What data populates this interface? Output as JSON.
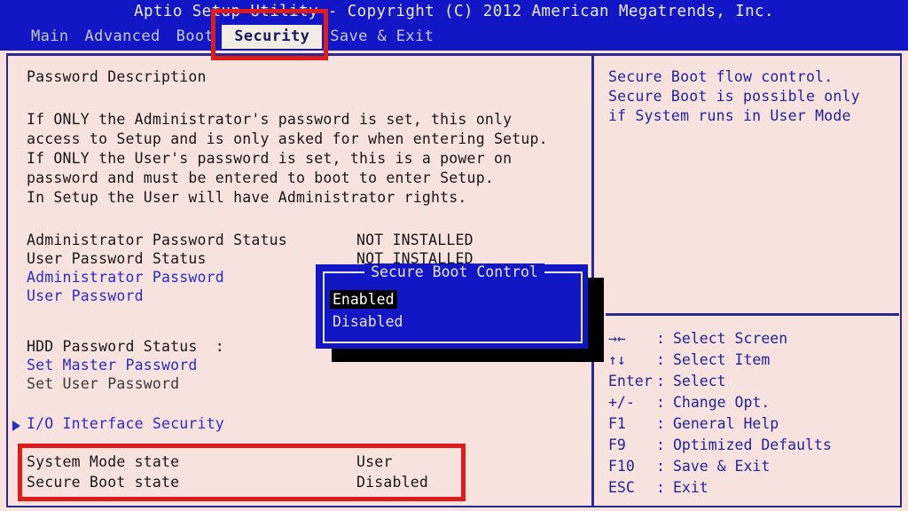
{
  "window": {
    "title": "Aptio Setup Utility - Copyright (C) 2012 American Megatrends, Inc."
  },
  "menu": {
    "tabs": [
      {
        "label": "Main",
        "active": false
      },
      {
        "label": "Advanced",
        "active": false
      },
      {
        "label": "Boot",
        "active": false
      },
      {
        "label": "Security",
        "active": true
      },
      {
        "label": "Save & Exit",
        "active": false
      }
    ]
  },
  "left_pane": {
    "section_title": "Password Description",
    "description_lines": [
      "If ONLY the Administrator's password is set, this only",
      "access to Setup and is only asked for when entering Setup.",
      "If ONLY the User's password is set, this is a power on",
      "password and must be entered to boot to enter Setup.",
      "In Setup the User will have Administrator rights."
    ],
    "status_rows": [
      {
        "label": "Administrator Password Status",
        "value": "NOT INSTALLED"
      },
      {
        "label": "User Password Status",
        "value": "NOT INSTALLED"
      }
    ],
    "password_items": [
      {
        "label": "Administrator Password",
        "state": "enabled"
      },
      {
        "label": "User Password",
        "state": "enabled"
      }
    ],
    "hdd_status_label": "HDD Password Status  :",
    "hdd_items": [
      {
        "label": "Set Master Password",
        "state": "enabled"
      },
      {
        "label": "Set User Password",
        "state": "disabled"
      }
    ],
    "submenu": {
      "marker": "triangle-right-icon",
      "label": "I/O Interface Security"
    },
    "state_rows": [
      {
        "label": "System Mode state",
        "value": "User"
      },
      {
        "label": "Secure Boot state",
        "value": "Disabled"
      }
    ]
  },
  "popup": {
    "title": "Secure Boot Control",
    "options": [
      {
        "label": "Enabled",
        "selected": true
      },
      {
        "label": "Disabled",
        "selected": false
      }
    ]
  },
  "right_pane": {
    "help_lines": [
      "Secure Boot flow control.",
      "Secure Boot is possible only",
      "if System runs in User Mode"
    ],
    "key_legend": [
      {
        "key": "→←",
        "sep": ":",
        "label": "Select Screen",
        "icon": "arrow-left-right-icon"
      },
      {
        "key": "↑↓",
        "sep": ":",
        "label": "Select Item",
        "icon": "arrow-up-down-icon"
      },
      {
        "key": "Enter",
        "sep": ":",
        "label": "Select",
        "icon": ""
      },
      {
        "key": "+/-",
        "sep": ":",
        "label": "Change Opt.",
        "icon": ""
      },
      {
        "key": "F1",
        "sep": ":",
        "label": "General Help",
        "icon": ""
      },
      {
        "key": "F9",
        "sep": ":",
        "label": "Optimized Defaults",
        "icon": ""
      },
      {
        "key": "F10",
        "sep": ":",
        "label": "Save & Exit",
        "icon": ""
      },
      {
        "key": "ESC",
        "sep": ":",
        "label": "Exit",
        "icon": ""
      }
    ]
  },
  "annotations": [
    {
      "name": "security-tab-highlight",
      "color": "#e01b1b"
    },
    {
      "name": "secure-boot-state-highlight",
      "color": "#e01b1b"
    }
  ],
  "colors": {
    "title_bar": "#1316c4",
    "screen_bg": "#f7e2de",
    "frame_border": "#2b2b8f",
    "link_blue": "#2b2bc8",
    "help_blue": "#23239c",
    "annotation_red": "#e01b1b",
    "popup_bg": "#1316c4",
    "popup_selected_bg": "#000000"
  }
}
